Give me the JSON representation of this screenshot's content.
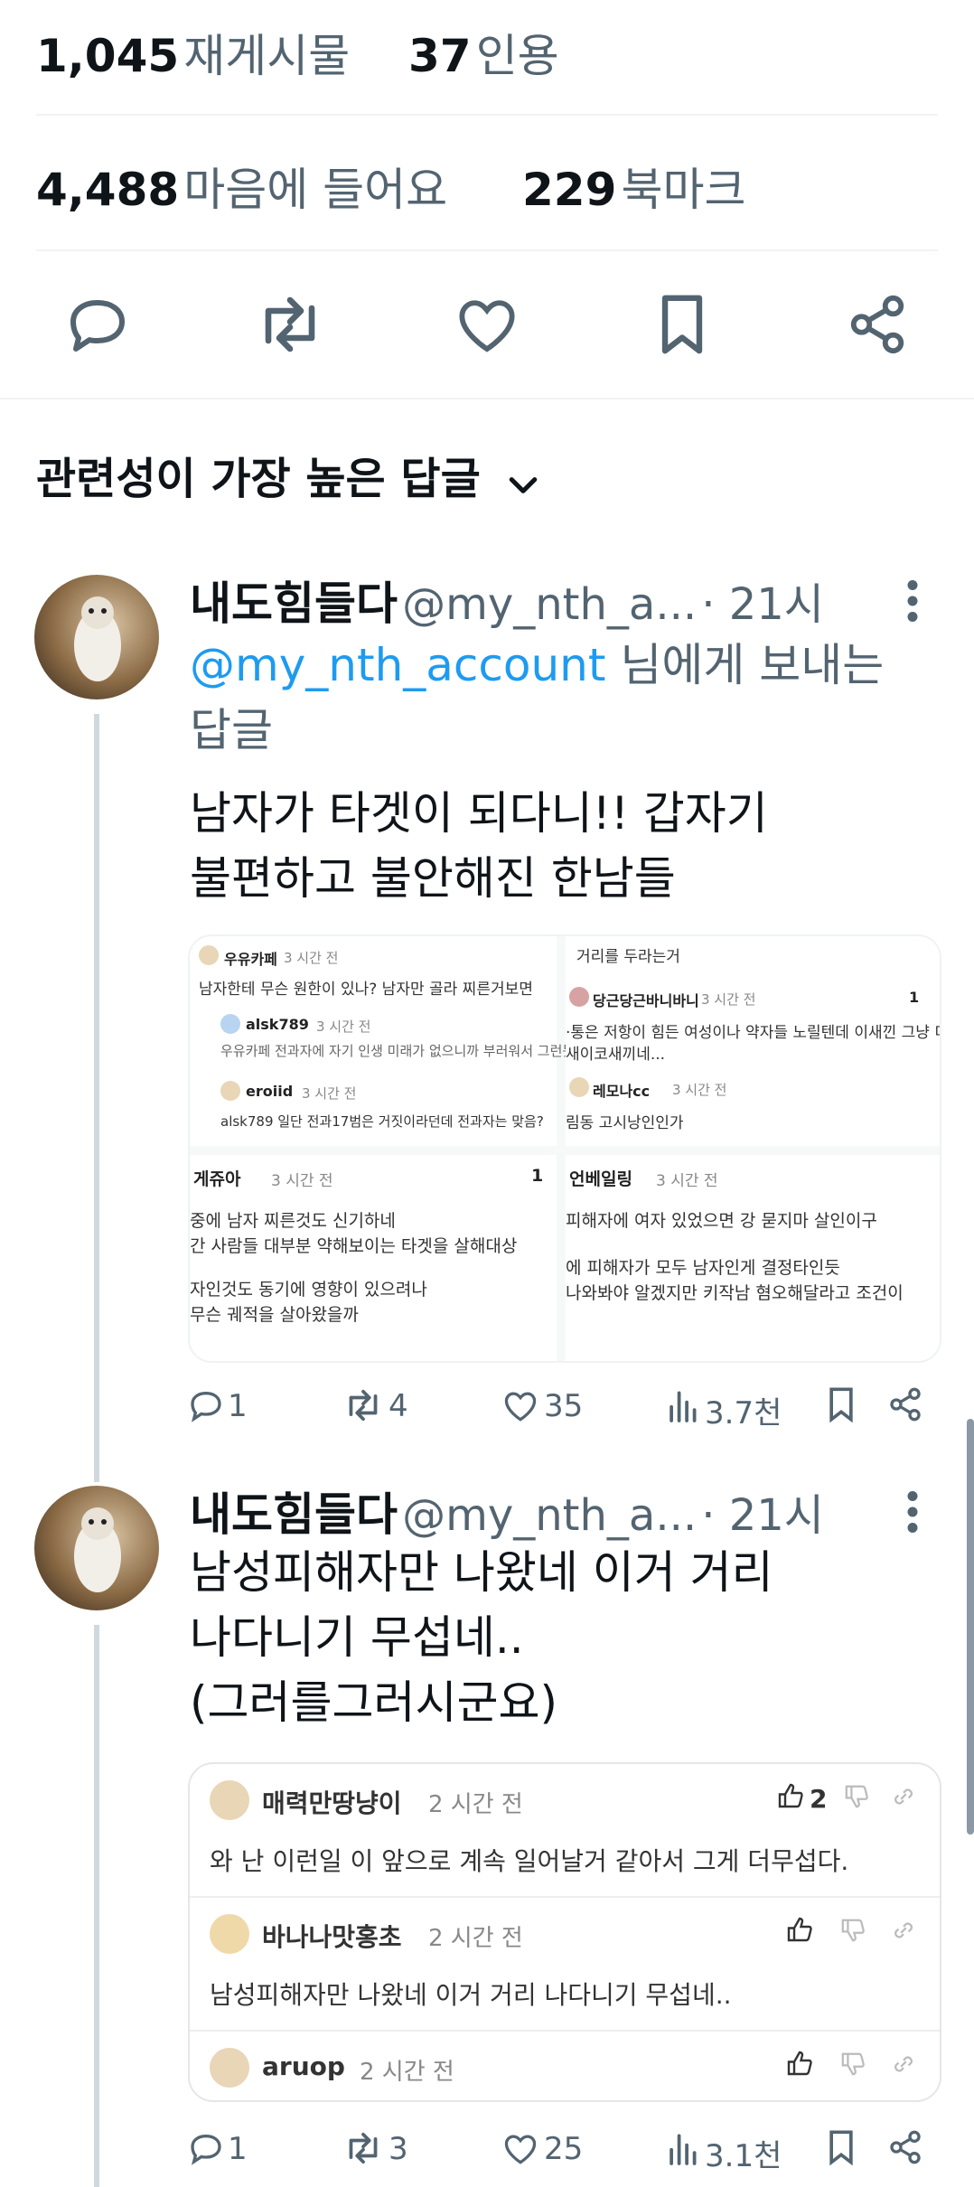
{
  "stats": {
    "reposts_count": "1,045",
    "reposts_label": "재게시물",
    "quotes_count": "37",
    "quotes_label": "인용",
    "likes_count": "4,488",
    "likes_label": "마음에 들어요",
    "bookmarks_count": "229",
    "bookmarks_label": "북마크"
  },
  "actions": [
    "reply-icon",
    "repost-icon",
    "like-icon",
    "bookmark-icon",
    "share-icon"
  ],
  "sort": {
    "label": "관련성이 가장 높은 답글"
  },
  "replies": [
    {
      "name": "내도힘들다",
      "handle": "@my_nth_a...",
      "time": "· 21시",
      "reply_to_mention": "@my_nth_account",
      "reply_to_suffix": "님에게 보내는",
      "reply_to_line2": "답글",
      "text_line1": "남자가 타겟이 되다니!! 갑자기",
      "text_line2": "불편하고 불안해진 한남들",
      "counts": {
        "replies": "1",
        "reposts": "4",
        "likes": "35",
        "views": "3.7천"
      },
      "image": {
        "tl": {
          "u1": "우유카페",
          "t1": "3 시간 전",
          "l1": "남자한테 무슨 원한이 있나? 남자만 골라 찌른거보면",
          "u2": "alsk789",
          "t2": "3 시간 전",
          "l2": "우유카페 전과자에 자기 인생 미래가 없으니까 부러워서 그런듯",
          "u3": "eroiid",
          "t3": "3 시간 전",
          "l3": "alsk789 일단 전과17범은 거짓이라던데 전과자는 맞음?"
        },
        "tr": {
          "l0": "거리를 두라는거",
          "u1": "당근당근바니바니",
          "t1": "3 시간 전",
          "n1": "1",
          "l1": "·통은 저항이 힘든 여성이나 약자들 노릴텐데 이새낀 그냥 미친",
          "l1b": "새이코새끼네...",
          "u2": "레모나cc",
          "t2": "3 시간 전",
          "l2": "림동 고시낭인인가"
        },
        "bl": {
          "u": "게쥬아",
          "t": "3 시간 전",
          "n": "1",
          "l1": "중에 남자 찌른것도 신기하네",
          "l2": "간 사람들 대부분 약해보이는 타겟을 살해대상",
          "l3": "자인것도 동기에 영향이 있으려나",
          "l4": "무슨 궤적을 살아왔을까"
        },
        "br": {
          "u": "언베일링",
          "t": "3 시간 전",
          "l1": "피해자에 여자 있었으면 강 묻지마 살인이구",
          "l2": "에 피해자가 모두 남자인게 결정타인듯",
          "l3": "나와봐야 알겠지만 키작남 혐오해달라고 조건이"
        }
      }
    },
    {
      "name": "내도힘들다",
      "handle": "@my_nth_a...",
      "time": "· 21시",
      "text_line1": "남성피해자만 나왔네 이거 거리",
      "text_line2": "나다니기 무섭네..",
      "text_line3": "(그러를그러시군요)",
      "counts": {
        "replies": "1",
        "reposts": "3",
        "likes": "25",
        "views": "3.1천"
      },
      "card": [
        {
          "user": "매력만땅냥이",
          "time": "2 시간 전",
          "likes": "2",
          "text": "와 난 이런일 이 앞으로 계속 일어날거 같아서 그게 더무섭다."
        },
        {
          "user": "바나나맛홍초",
          "time": "2 시간 전",
          "likes": "",
          "text": "남성피해자만 나왔네 이거 거리 나다니기 무섭네.."
        },
        {
          "user": "aruop",
          "time": "2 시간 전",
          "likes": "",
          "text": ""
        }
      ]
    }
  ]
}
